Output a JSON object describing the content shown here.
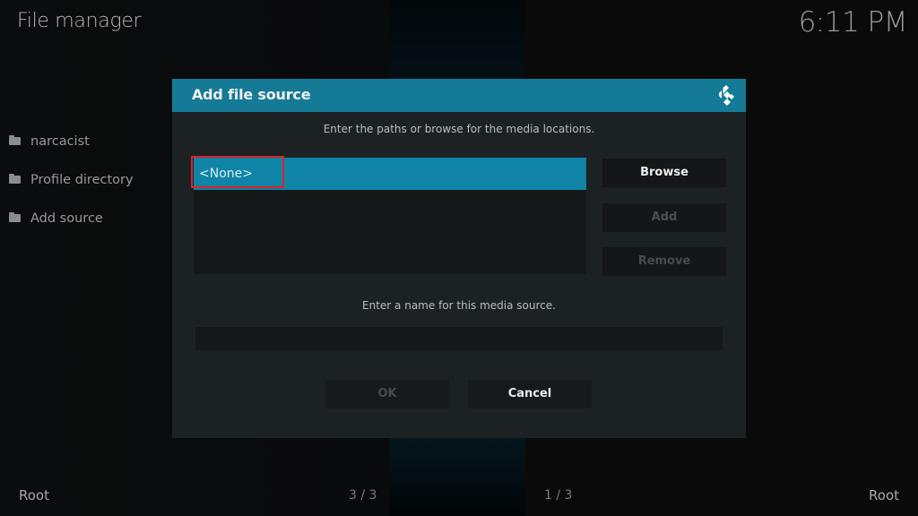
{
  "header": {
    "title": "File manager",
    "clock": "6:11 PM"
  },
  "sidebar": {
    "items": [
      {
        "label": "narcacist",
        "icon": "folder-icon"
      },
      {
        "label": "Profile directory",
        "icon": "folder-icon"
      },
      {
        "label": "Add source",
        "icon": "folder-icon"
      }
    ]
  },
  "footer": {
    "left_label": "Root",
    "left_page": "3 / 3",
    "right_page": "1 / 3",
    "right_label": "Root"
  },
  "dialog": {
    "title": "Add file source",
    "logo_icon": "kodi-logo-icon",
    "paths_hint": "Enter the paths or browse for the media locations.",
    "paths": [
      {
        "label": "<None>",
        "selected": true
      }
    ],
    "buttons": {
      "browse": "Browse",
      "add": "Add",
      "remove": "Remove",
      "ok": "OK",
      "cancel": "Cancel"
    },
    "name_hint": "Enter a name for this media source.",
    "name_value": "",
    "colors": {
      "header": "#157a96",
      "selected_row": "#0f84a6",
      "highlight_border": "#e0202a"
    }
  }
}
